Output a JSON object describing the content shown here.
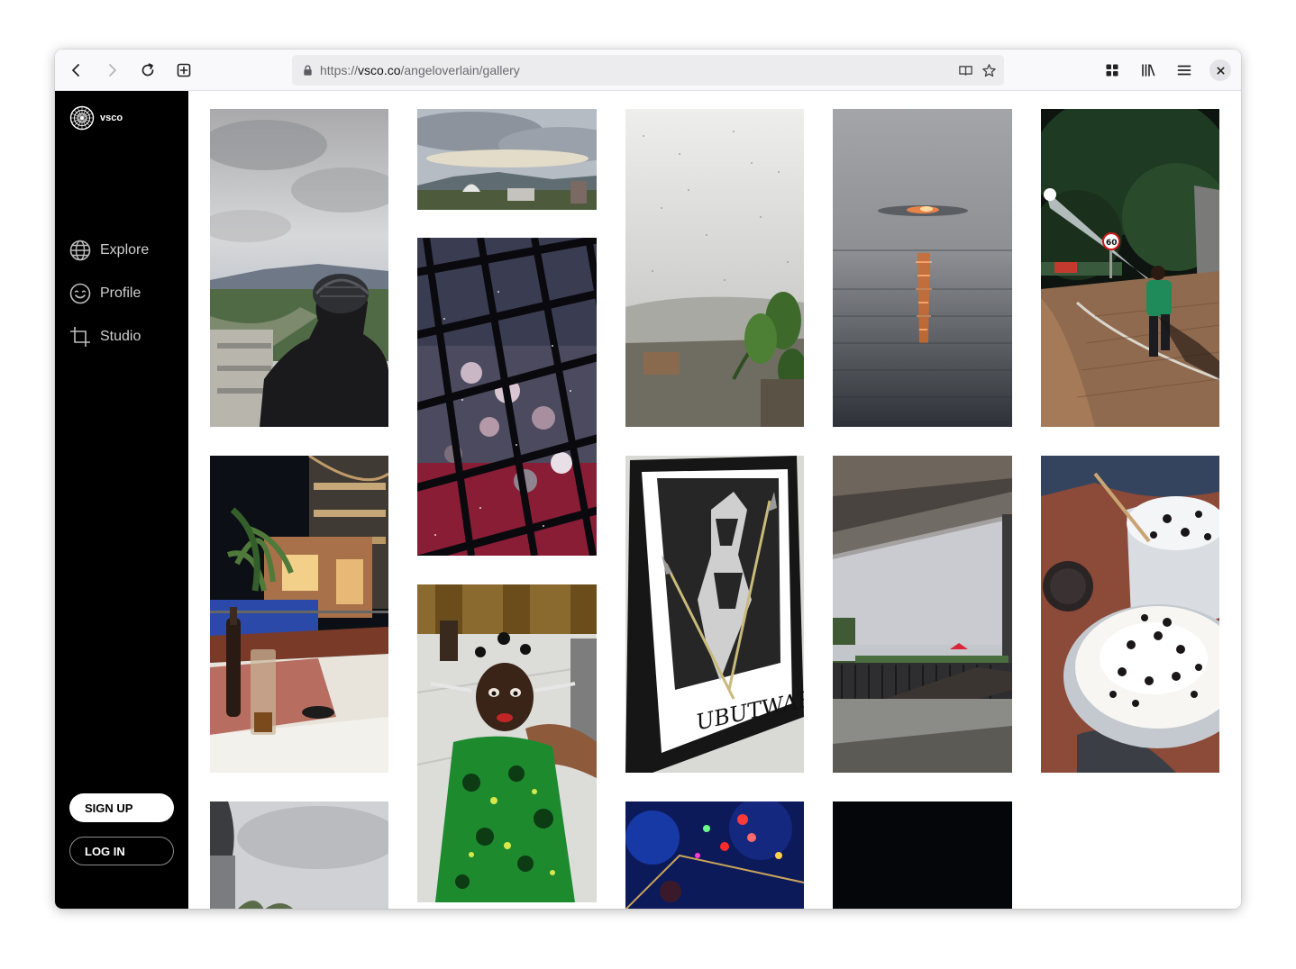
{
  "browser": {
    "url_prefix": "https://",
    "url_host": "vsco.co",
    "url_path": "/angeloverlain/gallery",
    "icons": {
      "back": "back-arrow-icon",
      "forward": "forward-arrow-icon",
      "reload": "reload-icon",
      "new_tab": "new-tab-icon",
      "lock": "lock-icon",
      "reader": "reader-view-icon",
      "bookmark": "star-icon",
      "extensions": "grid-icon",
      "library": "library-icon",
      "menu": "hamburger-menu-icon",
      "close": "close-icon"
    }
  },
  "sidebar": {
    "logo_text": "vsco",
    "nav": [
      {
        "label": "Explore",
        "icon": "globe-icon"
      },
      {
        "label": "Profile",
        "icon": "smiley-icon"
      },
      {
        "label": "Studio",
        "icon": "crop-icon"
      }
    ],
    "signup_label": "SIGN UP",
    "login_label": "LOG IN"
  },
  "gallery": {
    "photos": [
      {
        "subject": "Cyclist in helmet overlooking city under cloudy sky"
      },
      {
        "subject": "City skyline with domed building"
      },
      {
        "subject": "Rain-speckled window over hillside with plant"
      },
      {
        "subject": "Sunset over lake"
      },
      {
        "subject": "Person walking on brick sidewalk at night, speed limit sign 60"
      },
      {
        "subject": "Glass floor above crowded party"
      },
      {
        "subject": "Hotel terrace at night with bottle and glass"
      },
      {
        "subject": "Framed Ubutwari artwork with spears"
      },
      {
        "subject": "Lakeside view from covered balcony"
      },
      {
        "subject": "Ice cream cups with chocolate chips"
      },
      {
        "subject": "Doll in green patterned dress held by hand"
      },
      {
        "subject": "Building and cloudy sky"
      },
      {
        "subject": "Colorful festive lights at night"
      },
      {
        "subject": "Dark night photo"
      }
    ],
    "sign_text": "60",
    "artwork_text": "UBUTWARI"
  }
}
